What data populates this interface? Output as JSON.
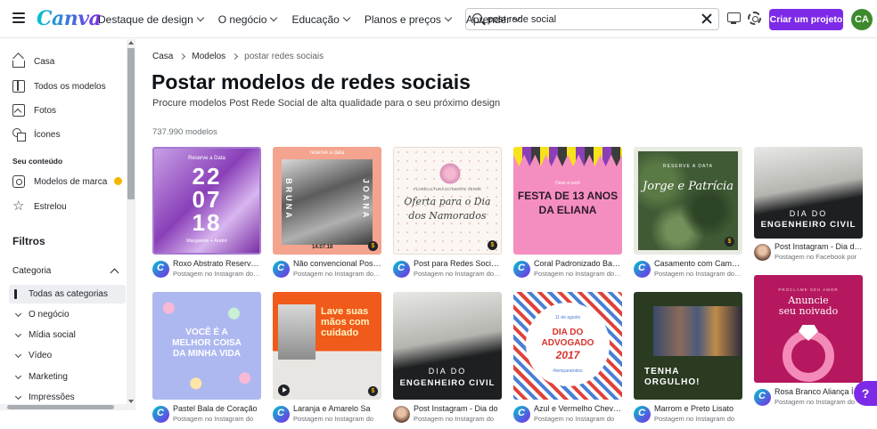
{
  "header": {
    "logo": "Canva",
    "nav": [
      {
        "label": "Destaque de design"
      },
      {
        "label": "O negócio"
      },
      {
        "label": "Educação"
      },
      {
        "label": "Planos e preços"
      },
      {
        "label": "Aprender"
      }
    ],
    "search": {
      "value": "post rede social",
      "placeholder": ""
    },
    "create_button": "Criar um projeto",
    "avatar_initials": "CA"
  },
  "sidebar": {
    "items": [
      {
        "label": "Casa",
        "icon": "home-icon"
      },
      {
        "label": "Todos os modelos",
        "icon": "templates-icon"
      },
      {
        "label": "Fotos",
        "icon": "photo-icon"
      },
      {
        "label": "Ícones",
        "icon": "shapes-icon"
      }
    ],
    "section_label": "Seu conteúdo",
    "content_items": [
      {
        "label": "Modelos de marca",
        "icon": "brand-icon"
      },
      {
        "label": "Estrelou",
        "icon": "star-icon"
      }
    ],
    "filters_title": "Filtros",
    "category_label": "Categoria",
    "categories": [
      {
        "label": "Todas as categorias",
        "active": true
      },
      {
        "label": "O negócio"
      },
      {
        "label": "Mídia social"
      },
      {
        "label": "Vídeo"
      },
      {
        "label": "Marketing"
      },
      {
        "label": "Impressões"
      }
    ]
  },
  "main": {
    "breadcrumb": [
      "Casa",
      "Modelos",
      "postar redes sociais"
    ],
    "title": "Postar modelos de redes sociais",
    "subtitle": "Procure modelos Post Rede Social de alta qualidade para o seu próximo design",
    "count": "737.990 modelos"
  },
  "cards": [
    {
      "title": "Roxo Abstrato Reserve a Data",
      "subtitle": "Postagem no Instagram do Convite",
      "thumb_text": [
        "Reserve a Data",
        "22",
        "07",
        "18",
        "Margarete + André"
      ]
    },
    {
      "title": "Não convencional Post Reserve",
      "subtitle": "Postagem no Instagram do Convite",
      "thumb_text": [
        "reserve a data",
        "BRUNA",
        "JOANA",
        "14.07.18"
      ]
    },
    {
      "title": "Post para Redes Sociais Oferta",
      "subtitle": "Postagem no Instagram do Dia",
      "thumb_text": [
        "FLORICULTURA DO MONTE VERDE",
        "Oferta para o Dia",
        "dos Namorados"
      ]
    },
    {
      "title": "Coral Padronizado Banner Festa",
      "subtitle": "Postagem no Instagram do Aniversário",
      "thumb_text": [
        "Deus a você",
        "FESTA DE 13 ANOS",
        "DA ELIANA"
      ]
    },
    {
      "title": "Casamento com Camuflagem",
      "subtitle": "Postagem no Instagram do Convite",
      "thumb_text": [
        "RESERVE A DATA",
        "Jorge e Patrícia"
      ]
    },
    {
      "title": "Post Instagram - Dia do Engenheiro",
      "subtitle": "Postagem no Facebook por",
      "thumb_text": [
        "DIA DO",
        "ENGENHEIRO CIVIL"
      ]
    },
    {
      "title": "Pastel Bala de Coração",
      "subtitle": "Postagem no Instagram do",
      "thumb_text": [
        "VOCÊ É A",
        "MELHOR COISA",
        "DA MINHA VIDA"
      ]
    },
    {
      "title": "Laranja e Amarelo Sa",
      "subtitle": "Postagem no Instagram do",
      "thumb_text": [
        "Lave suas",
        "mãos com",
        "cuidado"
      ]
    },
    {
      "title": "Post Instagram - Dia do",
      "subtitle": "Postagem no Instagram do",
      "thumb_text": [
        "DIA DO",
        "ENGENHEIRO CIVIL"
      ]
    },
    {
      "title": "Azul e Vermelho Chevron",
      "subtitle": "Postagem no Instagram do",
      "thumb_text": [
        "11 de agosto",
        "DIA DO",
        "ADVOGADO",
        "2017",
        "#temparatodos"
      ]
    },
    {
      "title": "Marrom e Preto Lisato",
      "subtitle": "Postagem no Instagram do",
      "thumb_text": [
        "TENHA",
        "ORGULHO!"
      ]
    },
    {
      "title": "Rosa Branco Aliança Ícone",
      "subtitle": "Postagem no Instagram do",
      "thumb_text": [
        "PROCLAME SEU AMOR",
        "Anuncie",
        "seu noivado"
      ]
    }
  ],
  "help_label": "?",
  "colors": {
    "accent": "#7d2ae8",
    "avatar": "#3e8a2e"
  }
}
